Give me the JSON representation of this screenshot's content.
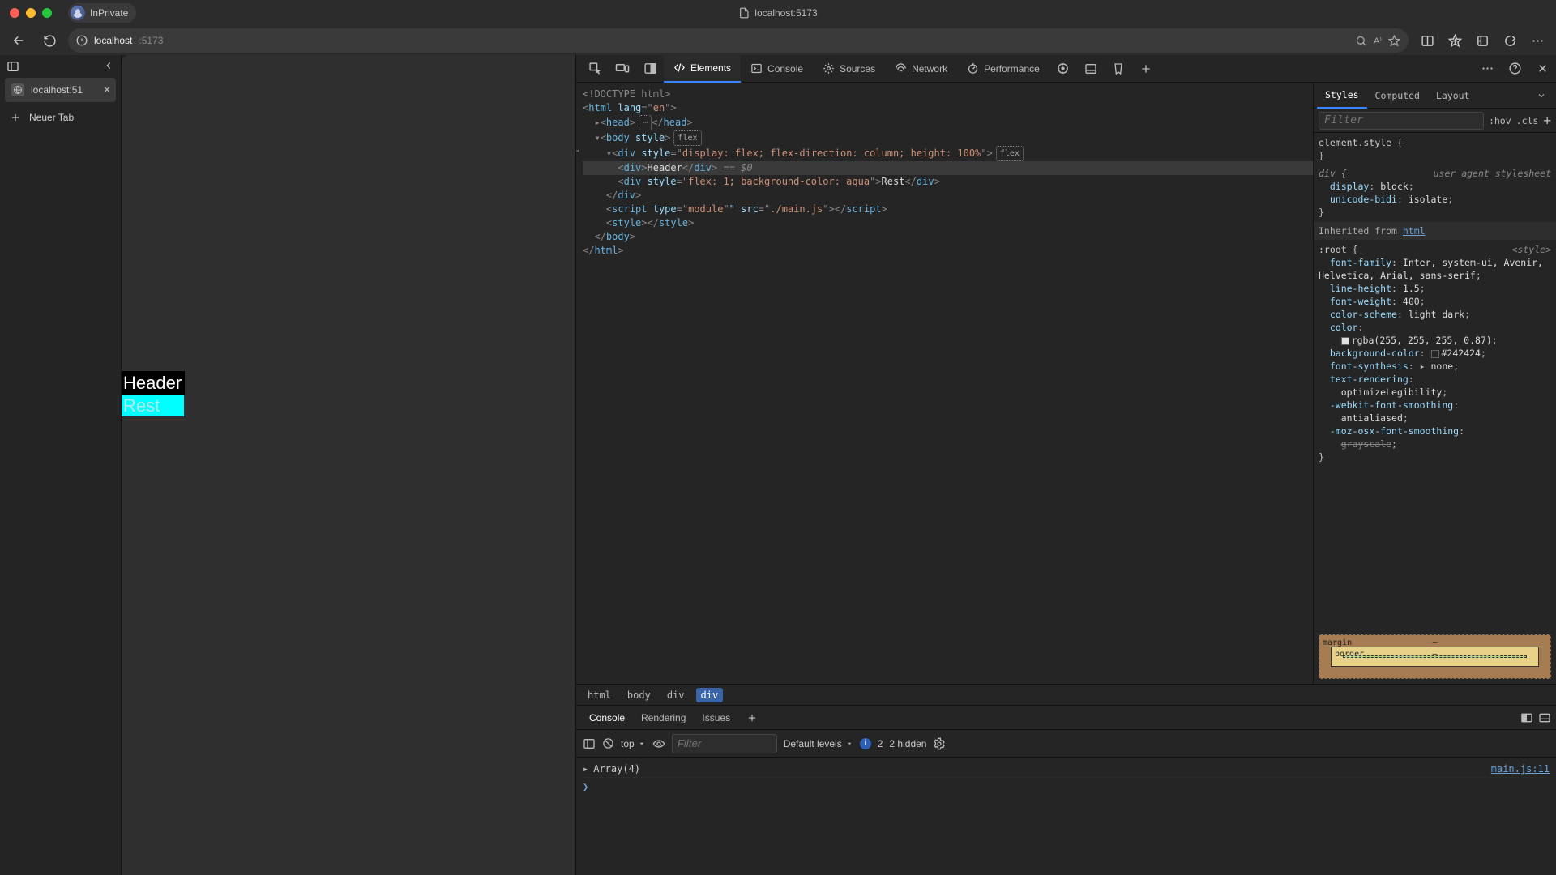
{
  "window": {
    "profile_label": "InPrivate",
    "title": "localhost:5173"
  },
  "toolbar": {
    "url_host": "localhost",
    "url_path": ":5173"
  },
  "tabs_sidebar": {
    "tab_title": "localhost:51",
    "new_tab_label": "Neuer Tab"
  },
  "page": {
    "header_text": "Header",
    "rest_text": "Rest"
  },
  "devtools": {
    "tabs": {
      "elements": "Elements",
      "console": "Console",
      "sources": "Sources",
      "network": "Network",
      "performance": "Performance"
    },
    "elements": {
      "l1": "<!DOCTYPE html>",
      "l2a": "<",
      "l2tag": "html",
      "l2b": " lang",
      "l2c": "=\"",
      "l2d": "en",
      "l2e": "\">",
      "l3a": "▸",
      "l3b": "<",
      "l3tag": "head",
      "l3c": ">",
      "l3dots": "⋯",
      "l3d": "</",
      "l3e": ">",
      "l4a": "▾",
      "l4b": "<",
      "l4tag": "body",
      "l4c": " style",
      "l4d": ">",
      "l4pill": "flex",
      "l5a": "▾",
      "l5b": "<",
      "l5tag": "div",
      "l5c": " style",
      "l5d": "=\"",
      "l5e": "display: flex; flex-direction: column; height: 100%",
      "l5f": "\">",
      "l5pill": "flex",
      "l6a": "<",
      "l6tag": "div",
      "l6b": ">",
      "l6txt": "Header",
      "l6c": "</",
      "l6d": ">",
      "l6sel": " == $0",
      "l7a": "<",
      "l7tag": "div",
      "l7b": " style",
      "l7c": "=\"",
      "l7d": "flex: 1; background-color: aqua",
      "l7e": "\">",
      "l7txt": "Rest",
      "l7f": "</",
      "l7g": ">",
      "l8": "</",
      "l8tag": "div",
      "l8b": ">",
      "l9a": "<",
      "l9tag": "script",
      "l9b": " type",
      "l9c": "=\"",
      "l9d": "module",
      "l9e": "\" src",
      "l9f": "=\"",
      "l9g": "./main.js",
      "l9h": "\"></",
      "l9i": ">",
      "l10a": "<",
      "l10tag": "style",
      "l10b": "></",
      "l10c": ">",
      "l11": "</",
      "l11tag": "body",
      "l11b": ">",
      "l12": "</",
      "l12tag": "html",
      "l12b": ">"
    },
    "breadcrumb": {
      "c1": "html",
      "c2": "body",
      "c3": "div",
      "c4": "div"
    },
    "styles": {
      "tabs": {
        "styles": "Styles",
        "computed": "Computed",
        "layout": "Layout"
      },
      "filter_ph": "Filter",
      "hov": ":hov",
      "cls": ".cls",
      "elstyle": "element.style {",
      "div_sel": "div {",
      "uas": "user agent stylesheet",
      "p1": "display",
      "v1": "block",
      "p2": "unicode-bidi",
      "v2": "isolate",
      "inherit_label": "Inherited from ",
      "inherit_link": "html",
      "root_sel": ":root {",
      "root_src": "<style>",
      "rp1": "font-family",
      "rv1": "Inter, system-ui, Avenir, Helvetica, Arial, sans-serif",
      "rp2": "line-height",
      "rv2": "1.5",
      "rp3": "font-weight",
      "rv3": "400",
      "rp4": "color-scheme",
      "rv4": "light dark",
      "rp5": "color",
      "rv5": "rgba(255, 255, 255, 0.87)",
      "rp6": "background-color",
      "rv6": "#242424",
      "rp7": "font-synthesis",
      "rv7": "none",
      "rp8": "text-rendering",
      "rv8": "optimizeLegibility",
      "rp9": "-webkit-font-smoothing",
      "rv9": "antialiased",
      "rp10": "-moz-osx-font-smoothing",
      "rv10": "grayscale",
      "box": {
        "margin": "margin",
        "border": "border",
        "dash": "–"
      }
    },
    "drawer": {
      "tabs": {
        "console": "Console",
        "rendering": "Rendering",
        "issues": "Issues"
      },
      "toolbar": {
        "context": "top",
        "filter_ph": "Filter",
        "levels": "Default levels",
        "info_count": "2",
        "hidden": "2 hidden"
      },
      "log1": "Array(4)",
      "src1": "main.js:11"
    }
  }
}
